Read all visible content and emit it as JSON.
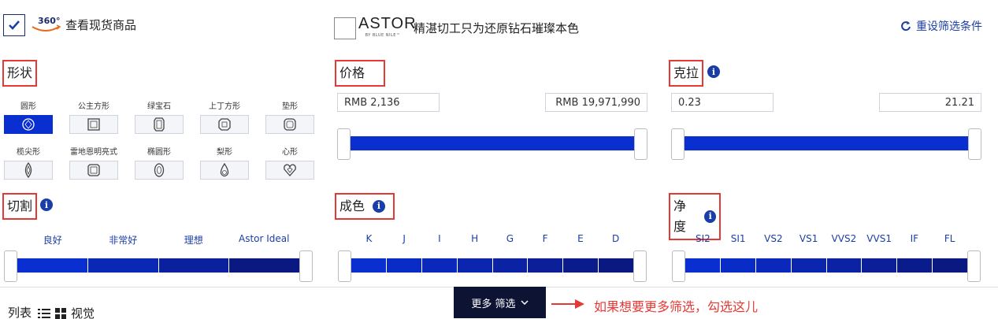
{
  "top": {
    "instock_checked": true,
    "badge_360": "360°",
    "instock_label": "查看现货商品",
    "astor_brand": "ASTOR",
    "astor_sub": "BY BLUE NILE™",
    "astor_label": "精湛切工只为还原钻石璀璨本色",
    "reset_label": "重设筛选条件"
  },
  "shape": {
    "title": "形状",
    "items": [
      {
        "label": "圆形",
        "icon": "round-icon",
        "selected": true
      },
      {
        "label": "公主方形",
        "icon": "princess-icon",
        "selected": false
      },
      {
        "label": "绿宝石",
        "icon": "emerald-icon",
        "selected": false
      },
      {
        "label": "上丁方形",
        "icon": "asscher-icon",
        "selected": false
      },
      {
        "label": "垫形",
        "icon": "cushion-icon",
        "selected": false
      },
      {
        "label": "榄尖形",
        "icon": "marquise-icon",
        "selected": false
      },
      {
        "label": "雷地恩明亮式",
        "icon": "radiant-icon",
        "selected": false
      },
      {
        "label": "椭圆形",
        "icon": "oval-icon",
        "selected": false
      },
      {
        "label": "梨形",
        "icon": "pear-icon",
        "selected": false
      },
      {
        "label": "心形",
        "icon": "heart-icon",
        "selected": false
      }
    ]
  },
  "price": {
    "title": "价格",
    "min": "RMB 2,136",
    "max": "RMB 19,971,990"
  },
  "carat": {
    "title": "克拉",
    "min": "0.23",
    "max": "21.21"
  },
  "cut": {
    "title": "切割",
    "ticks": [
      "良好",
      "非常好",
      "理想",
      "Astor Ideal"
    ]
  },
  "color": {
    "title": "成色",
    "ticks": [
      "K",
      "J",
      "I",
      "H",
      "G",
      "F",
      "E",
      "D"
    ]
  },
  "clarity": {
    "title": "净度",
    "ticks": [
      "SI2",
      "SI1",
      "VS2",
      "VS1",
      "VVS2",
      "VVS1",
      "IF",
      "FL"
    ]
  },
  "bottom": {
    "list_label": "列表",
    "visual_label": "视觉",
    "more_filters": "更多 筛选",
    "annotation": "如果想要更多筛选，勾选这儿"
  },
  "colors": {
    "accent": "#0a2fd1",
    "link": "#1a3ea8",
    "annotation": "#e53935",
    "dark_button": "#0d1433"
  }
}
